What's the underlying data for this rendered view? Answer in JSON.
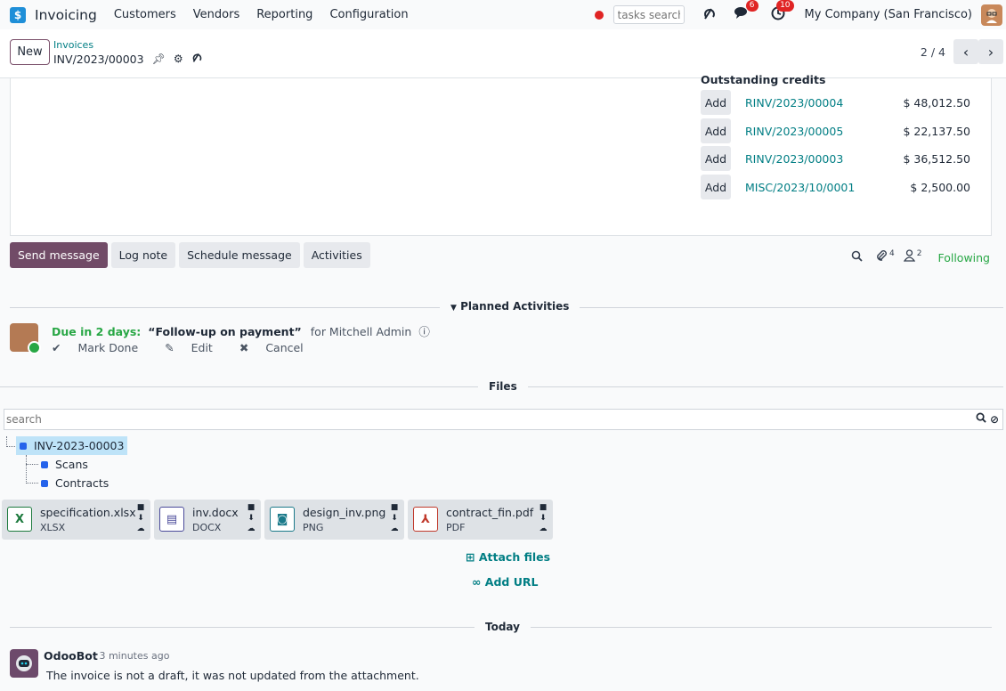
{
  "navbar": {
    "app_name": "Invoicing",
    "menu": [
      "Customers",
      "Vendors",
      "Reporting",
      "Configuration"
    ],
    "tasks_search_placeholder": "tasks search",
    "messages_badge": "6",
    "activities_badge": "10",
    "company": "My Company (San Francisco)"
  },
  "control_panel": {
    "new_label": "New",
    "breadcrumb_parent": "Invoices",
    "breadcrumb_current": "INV/2023/00003",
    "pager_value": "2 / 4"
  },
  "credits": {
    "title": "Outstanding credits",
    "add_label": "Add",
    "items": [
      {
        "ref": "RINV/2023/00004",
        "amount": "$ 48,012.50"
      },
      {
        "ref": "RINV/2023/00005",
        "amount": "$ 22,137.50"
      },
      {
        "ref": "RINV/2023/00003",
        "amount": "$ 36,512.50"
      },
      {
        "ref": "MISC/2023/10/0001",
        "amount": "$ 2,500.00"
      }
    ]
  },
  "chatter": {
    "send_message": "Send message",
    "log_note": "Log note",
    "schedule_message": "Schedule message",
    "activities": "Activities",
    "attachments_count": "4",
    "followers_count": "2",
    "following": "Following"
  },
  "planned": {
    "header": "Planned Activities",
    "due": "Due in 2 days:",
    "summary": "“Follow-up on payment”",
    "for": "for Mitchell Admin",
    "mark_done": "Mark Done",
    "edit": "Edit",
    "cancel": "Cancel"
  },
  "files": {
    "header": "Files",
    "search_placeholder": "search",
    "tree": {
      "root": "INV-2023-00003",
      "children": [
        "Scans",
        "Contracts"
      ]
    },
    "cards": [
      {
        "name": "specification.xlsx",
        "ext": "XLSX",
        "thumb": "X",
        "color": "#1d7a3e"
      },
      {
        "name": "inv.docx",
        "ext": "DOCX",
        "thumb": "▤",
        "color": "#4a4a9a"
      },
      {
        "name": "design_inv.png",
        "ext": "PNG",
        "thumb": "◙",
        "color": "#1b7a8a"
      },
      {
        "name": "contract_fin.pdf",
        "ext": "PDF",
        "thumb": "⅄",
        "color": "#c0392b"
      }
    ],
    "attach_files": "Attach files",
    "add_url": "Add URL"
  },
  "messages": {
    "today": "Today",
    "author": "OdooBot",
    "date": "- 3 minutes ago",
    "body": "The invoice is not a draft, it was not updated from the attachment."
  }
}
